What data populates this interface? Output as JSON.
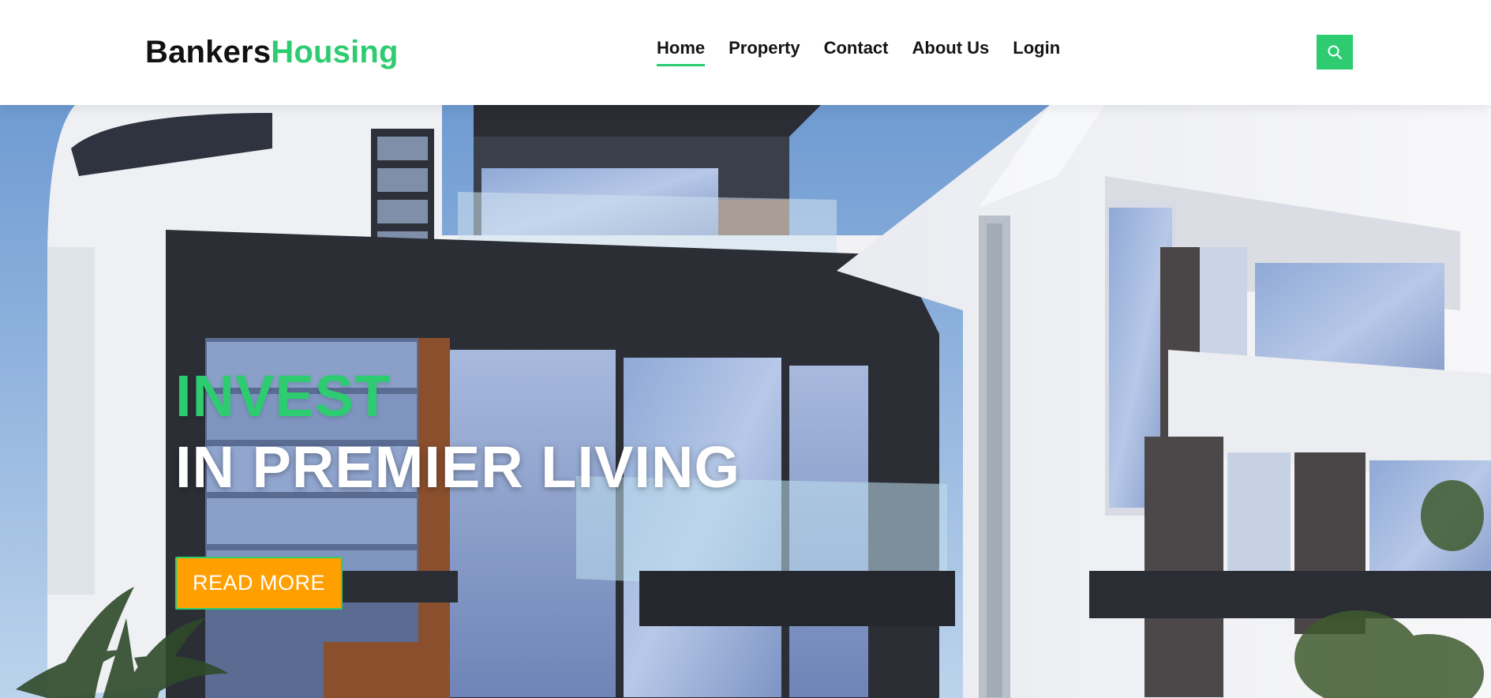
{
  "brand": {
    "name_part_1": "Bankers",
    "name_part_2": "Housing"
  },
  "nav": {
    "items": [
      {
        "label": "Home",
        "active": true
      },
      {
        "label": "Property",
        "active": false
      },
      {
        "label": "Contact",
        "active": false
      },
      {
        "label": "About Us",
        "active": false
      },
      {
        "label": "Login",
        "active": false
      }
    ],
    "search_icon": "search-icon"
  },
  "hero": {
    "title_line_1": "INVEST",
    "title_line_2": "IN PREMIER LIVING",
    "cta_label": "READ MORE",
    "background": "modern-house-photo"
  },
  "colors": {
    "accent_green": "#2ecc71",
    "cta_orange": "#ff9f00",
    "text_dark": "#141414",
    "text_white": "#ffffff"
  }
}
